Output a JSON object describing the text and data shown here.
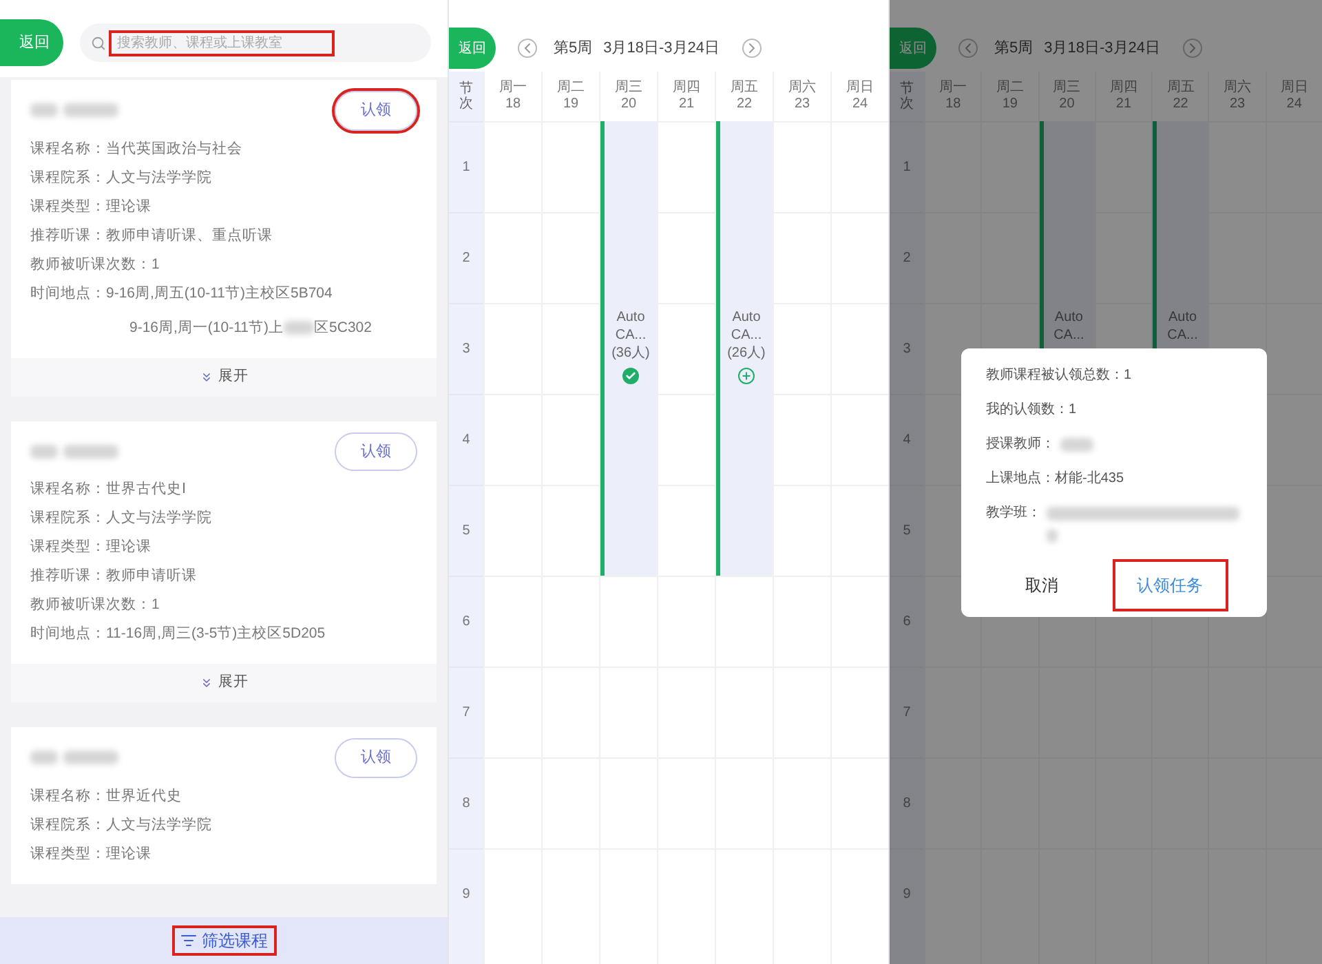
{
  "list_screen": {
    "back_button": "返回",
    "search": {
      "placeholder": "搜索教师、课程或上课教室",
      "highlighted": true
    },
    "cards": [
      {
        "claim_button": {
          "label": "认领",
          "highlighted": true
        },
        "fields": [
          "课程名称：当代英国政治与社会",
          "课程院系：人文与法学学院",
          "课程类型：理论课",
          "推荐听课：教师申请听课、重点听课",
          "教师被听课次数：1",
          "时间地点：9-16周,周五(10-11节)主校区5B704"
        ],
        "extra_line": {
          "before": "9-16周,周一(10-11节)上",
          "after": "区5C302"
        },
        "toggle": "展开"
      },
      {
        "claim_button": {
          "label": "认领",
          "highlighted": false
        },
        "fields": [
          "课程名称：世界古代史Ⅰ",
          "课程院系：人文与法学学院",
          "课程类型：理论课",
          "推荐听课：教师申请听课",
          "教师被听课次数：1",
          "时间地点：11-16周,周三(3-5节)主校区5D205"
        ],
        "toggle": "展开"
      },
      {
        "claim_button": {
          "label": "认领",
          "highlighted": false
        },
        "fields": [
          "课程名称：世界近代史",
          "课程院系：人文与法学学院",
          "课程类型：理论课"
        ]
      }
    ],
    "filter_button": {
      "label": "筛选课程",
      "highlighted": true
    }
  },
  "schedule_screen": {
    "back_button": "返回",
    "week": "第5周",
    "range": "3月18日-3月24日",
    "corner": "节次",
    "days": [
      {
        "name": "周一",
        "date": "18"
      },
      {
        "name": "周二",
        "date": "19"
      },
      {
        "name": "周三",
        "date": "20",
        "event": {
          "lines": [
            "Auto",
            "CA...",
            "(36人)"
          ],
          "claimed": true
        }
      },
      {
        "name": "周四",
        "date": "21"
      },
      {
        "name": "周五",
        "date": "22",
        "event": {
          "lines": [
            "Auto",
            "CA...",
            "(26人)"
          ],
          "claimed": false
        }
      },
      {
        "name": "周六",
        "date": "23"
      },
      {
        "name": "周日",
        "date": "24"
      }
    ],
    "periods": [
      "1",
      "2",
      "3",
      "4",
      "5",
      "6",
      "7",
      "8",
      "9"
    ]
  },
  "claim_screen": {
    "back_button": "返回",
    "week": "第5周",
    "range": "3月18日-3月24日",
    "corner": "节次",
    "days": [
      {
        "name": "周一",
        "date": "18"
      },
      {
        "name": "周二",
        "date": "19"
      },
      {
        "name": "周三",
        "date": "20",
        "event": {
          "lines": [
            "Auto",
            "CA..."
          ]
        }
      },
      {
        "name": "周四",
        "date": "21"
      },
      {
        "name": "周五",
        "date": "22",
        "event": {
          "lines": [
            "Auto",
            "CA..."
          ]
        }
      },
      {
        "name": "周六",
        "date": "23"
      },
      {
        "name": "周日",
        "date": "24"
      }
    ],
    "periods": [
      "1",
      "2",
      "3",
      "4",
      "5",
      "6",
      "7",
      "8",
      "9"
    ],
    "dialog": {
      "lines": [
        "教师课程被认领总数：1",
        "我的认领数：1"
      ],
      "teacher_label": "授课教师：",
      "location": "上课地点：材能-北435",
      "class_label": "教学班：",
      "cancel_button": "取消",
      "confirm_button": {
        "label": "认领任务",
        "highlighted": true
      }
    }
  }
}
